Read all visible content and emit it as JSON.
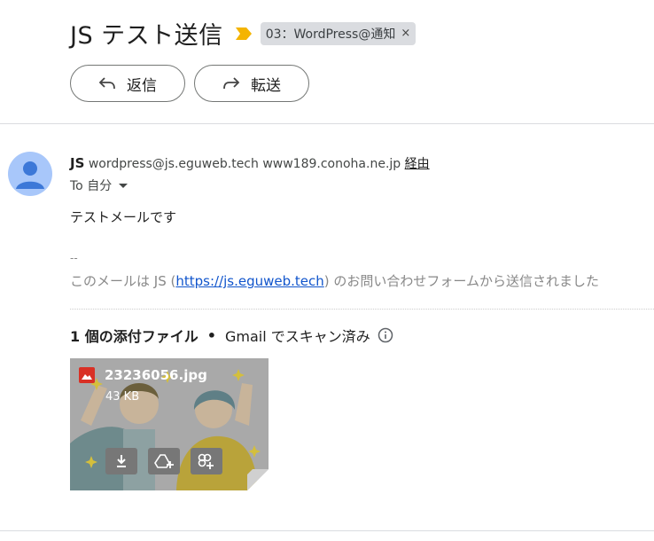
{
  "header": {
    "subject": "JS テスト送信",
    "label": "03：WordPress@通知",
    "label_close": "×"
  },
  "actions": {
    "reply_label": "返信",
    "forward_label": "転送"
  },
  "message": {
    "sender_name": "JS",
    "sender_email": "wordpress@js.eguweb.tech",
    "via_server": "www189.conoha.ne.jp",
    "via_label": "経由",
    "to_label": "To 自分",
    "body": "テストメールです",
    "sig_dash": "--",
    "sig_prefix": "このメールは JS (",
    "sig_link": "https://js.eguweb.tech",
    "sig_suffix": ") のお問い合わせフォームから送信されました"
  },
  "attachments": {
    "count_label": "1 個の添付ファイル",
    "separator": "•",
    "scan_label": "Gmail でスキャン済み",
    "file_name": "23236056.jpg",
    "file_size": "43 KB"
  },
  "colors": {
    "accent": "#0b57d0",
    "avatar_bg": "#a8c7fa",
    "file_icon": "#d93025",
    "importance": "#f4b400"
  }
}
